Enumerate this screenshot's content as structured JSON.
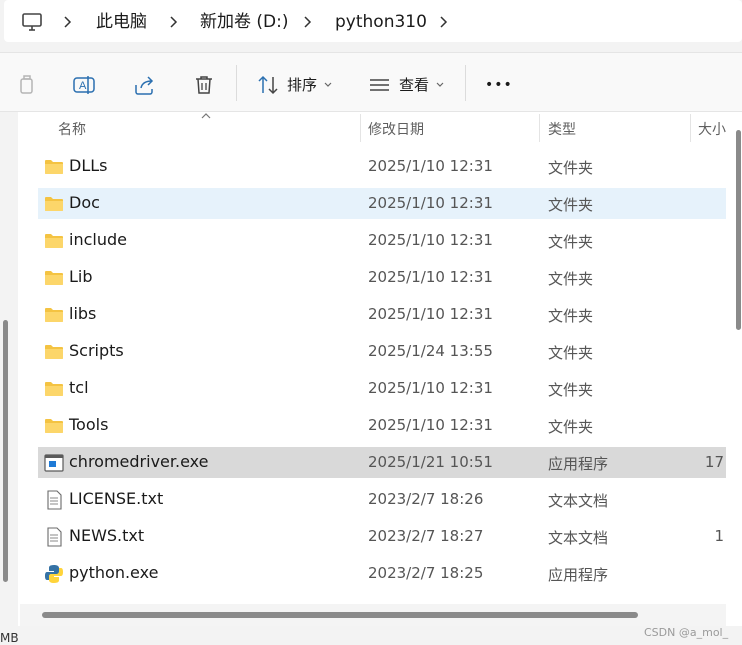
{
  "address_bar": {
    "crumbs": [
      "此电脑",
      "新加卷 (D:)",
      "python310"
    ]
  },
  "toolbar": {
    "sort_label": "排序",
    "view_label": "查看",
    "more_label": "•••"
  },
  "columns": {
    "name": "名称",
    "date": "修改日期",
    "type": "类型",
    "size": "大小"
  },
  "files": [
    {
      "icon": "folder-icon",
      "name": "DLLs",
      "date": "2025/1/10 12:31",
      "type": "文件夹",
      "size": ""
    },
    {
      "icon": "folder-icon",
      "name": "Doc",
      "date": "2025/1/10 12:31",
      "type": "文件夹",
      "size": ""
    },
    {
      "icon": "folder-icon",
      "name": "include",
      "date": "2025/1/10 12:31",
      "type": "文件夹",
      "size": ""
    },
    {
      "icon": "folder-icon",
      "name": "Lib",
      "date": "2025/1/10 12:31",
      "type": "文件夹",
      "size": ""
    },
    {
      "icon": "folder-icon",
      "name": "libs",
      "date": "2025/1/10 12:31",
      "type": "文件夹",
      "size": ""
    },
    {
      "icon": "folder-icon",
      "name": "Scripts",
      "date": "2025/1/24 13:55",
      "type": "文件夹",
      "size": ""
    },
    {
      "icon": "folder-icon",
      "name": "tcl",
      "date": "2025/1/10 12:31",
      "type": "文件夹",
      "size": ""
    },
    {
      "icon": "folder-icon",
      "name": "Tools",
      "date": "2025/1/10 12:31",
      "type": "文件夹",
      "size": ""
    },
    {
      "icon": "exe-icon",
      "name": "chromedriver.exe",
      "date": "2025/1/21 10:51",
      "type": "应用程序",
      "size": "17"
    },
    {
      "icon": "text-file-icon",
      "name": "LICENSE.txt",
      "date": "2023/2/7 18:26",
      "type": "文本文档",
      "size": ""
    },
    {
      "icon": "text-file-icon",
      "name": "NEWS.txt",
      "date": "2023/2/7 18:27",
      "type": "文本文档",
      "size": "1"
    },
    {
      "icon": "python-icon",
      "name": "python.exe",
      "date": "2023/2/7 18:25",
      "type": "应用程序",
      "size": ""
    }
  ],
  "status": {
    "text": "MB"
  },
  "watermark": "CSDN @a_mol_"
}
